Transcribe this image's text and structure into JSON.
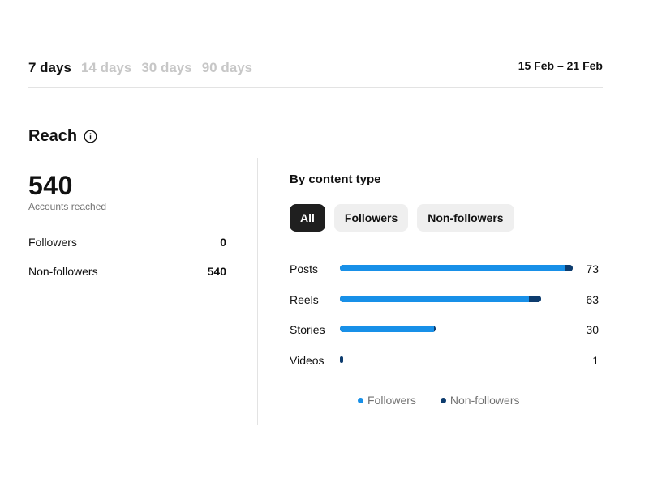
{
  "periods": [
    {
      "label": "7 days",
      "active": true
    },
    {
      "label": "14 days",
      "active": false
    },
    {
      "label": "30 days",
      "active": false
    },
    {
      "label": "90 days",
      "active": false
    }
  ],
  "date_range": "15 Feb – 21 Feb",
  "reach": {
    "title": "Reach",
    "total": "540",
    "total_label": "Accounts reached",
    "followers_label": "Followers",
    "followers_value": "0",
    "non_followers_label": "Non-followers",
    "non_followers_value": "540"
  },
  "by_content": {
    "heading": "By content type",
    "chips": [
      {
        "label": "All",
        "active": true
      },
      {
        "label": "Followers",
        "active": false
      },
      {
        "label": "Non-followers",
        "active": false
      }
    ],
    "rows": [
      {
        "label": "Posts",
        "value": "73",
        "total": 73,
        "followers_share": 0.97
      },
      {
        "label": "Reels",
        "value": "63",
        "total": 63,
        "followers_share": 0.94
      },
      {
        "label": "Stories",
        "value": "30",
        "total": 30,
        "followers_share": 0.98
      },
      {
        "label": "Videos",
        "value": "1",
        "total": 1,
        "followers_share": 0.0
      }
    ],
    "max_value": 73,
    "legend": {
      "followers": "Followers",
      "non_followers": "Non-followers"
    }
  },
  "colors": {
    "followers": "#1890e8",
    "non_followers": "#0d3c6e",
    "chip_active_bg": "#1f1f1f",
    "chip_bg": "#efefef",
    "inactive_text": "#c7c7c7"
  }
}
